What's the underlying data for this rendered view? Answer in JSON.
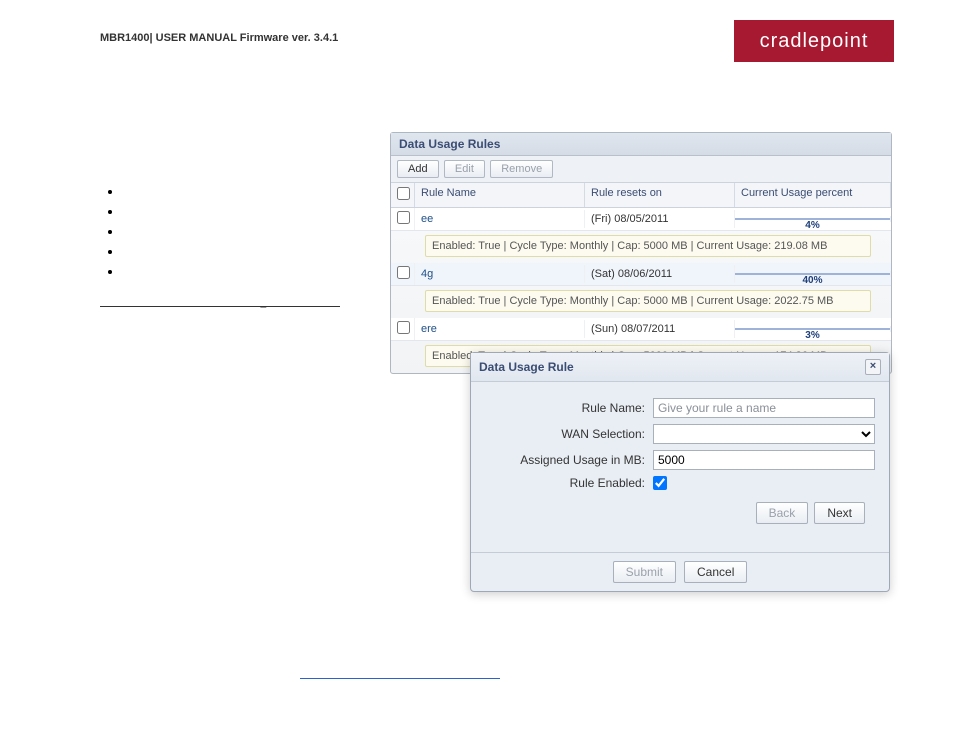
{
  "header": {
    "left": "MBR1400| USER MANUAL Firmware ver. 3.4.1",
    "brand": "cradlepoint"
  },
  "left": {
    "bullets": [
      "",
      "",
      "",
      "",
      ""
    ]
  },
  "usage_panel": {
    "title": "Data Usage Rules",
    "toolbar": {
      "add": "Add",
      "edit": "Edit",
      "remove": "Remove"
    },
    "cols": {
      "name": "Rule Name",
      "reset": "Rule resets on",
      "usage": "Current Usage percent"
    },
    "rows": [
      {
        "name": "ee",
        "reset": "(Fri) 08/05/2011",
        "pct": 4,
        "detail": "Enabled: True | Cycle Type: Monthly | Cap: 5000 MB | Current Usage: 219.08 MB"
      },
      {
        "name": "4g",
        "reset": "(Sat) 08/06/2011",
        "pct": 40,
        "detail": "Enabled: True | Cycle Type: Monthly | Cap: 5000 MB | Current Usage: 2022.75 MB"
      },
      {
        "name": "ere",
        "reset": "(Sun) 08/07/2011",
        "pct": 3,
        "detail": "Enabled: True | Cycle Type: Monthly | Cap: 5000 MB | Current Usage: 174.86 MB"
      }
    ]
  },
  "dialog": {
    "title": "Data Usage Rule",
    "labels": {
      "rule_name": "Rule Name:",
      "wan": "WAN Selection:",
      "assigned": "Assigned Usage in MB:",
      "enabled": "Rule Enabled:"
    },
    "placeholders": {
      "rule_name": "Give your rule a name"
    },
    "values": {
      "rule_name": "",
      "wan": "",
      "assigned": "5000",
      "enabled": true
    },
    "nav": {
      "back": "Back",
      "next": "Next"
    },
    "footer": {
      "submit": "Submit",
      "cancel": "Cancel"
    }
  }
}
